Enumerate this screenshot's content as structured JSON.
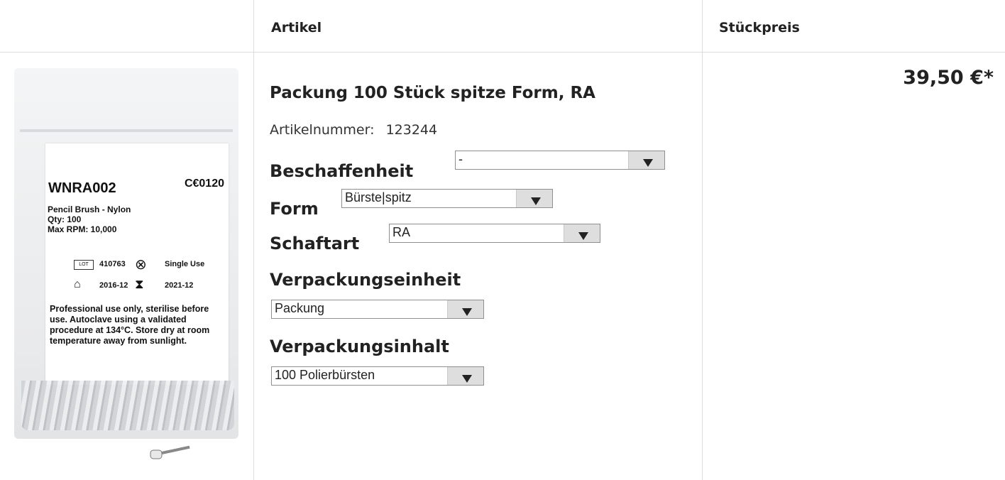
{
  "table": {
    "headers": {
      "article": "Artikel",
      "unit_price": "Stückpreis"
    }
  },
  "product_image": {
    "code": "WNRA002",
    "ce_mark": "C€0120",
    "name": "Pencil Brush - Nylon",
    "qty": "Qty: 100",
    "rpm": "Max RPM: 10,000",
    "lot_box": "LOT",
    "lot": "410763",
    "single_use": "Single Use",
    "manufactured": "2016-12",
    "expiry": "2021-12",
    "instructions": "Professional use only, sterilise before use. Autoclave using a validated procedure at 134°C. Store dry at room temperature away from sunlight."
  },
  "product": {
    "title": "Packung 100 Stück spitze Form, RA",
    "article_number_label": "Artikelnummer:",
    "article_number": "123244",
    "price": "39,50 €*"
  },
  "options": {
    "beschaffenheit": {
      "label": "Beschaffenheit",
      "value": "-"
    },
    "form": {
      "label": "Form",
      "value": "Bürste|spitz"
    },
    "schaftart": {
      "label": "Schaftart",
      "value": "RA"
    },
    "verpackungseinheit": {
      "label": "Verpackungseinheit",
      "value": "Packung"
    },
    "verpackungsinhalt": {
      "label": "Verpackungsinhalt",
      "value": "100 Polierbürsten"
    }
  }
}
